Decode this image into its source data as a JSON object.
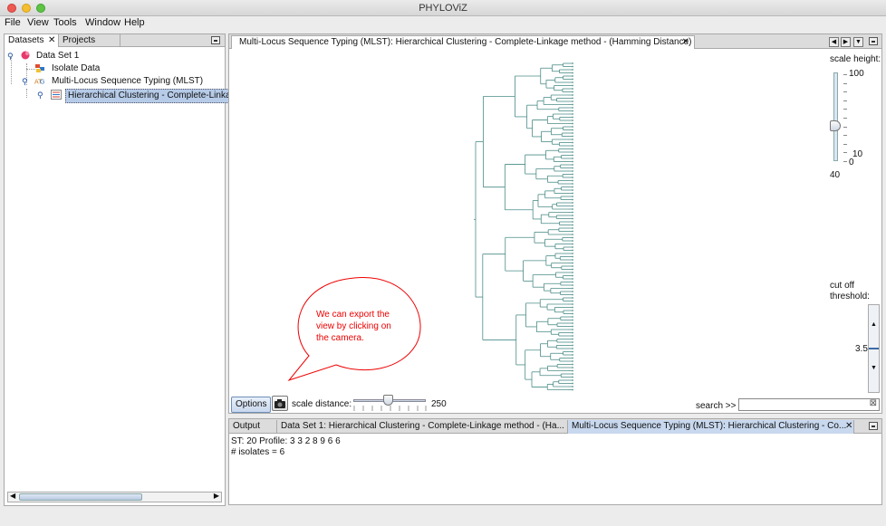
{
  "window": {
    "title": "PHYLOViZ"
  },
  "menu": [
    {
      "label": "File",
      "accel": "F"
    },
    {
      "label": "View",
      "accel": "V"
    },
    {
      "label": "Tools",
      "accel": "T"
    },
    {
      "label": "Window",
      "accel": "W"
    },
    {
      "label": "Help",
      "accel": "H"
    }
  ],
  "left_panel": {
    "tabs": [
      "Datasets",
      "Projects"
    ],
    "tree": {
      "dataset": "Data Set 1",
      "isolate": "Isolate Data",
      "mlst": "Multi-Locus Sequence Typing (MLST)",
      "clustering": "Hierarchical Clustering  - Complete-Linkage"
    }
  },
  "main_panel": {
    "tab_title": "Multi-Locus Sequence Typing (MLST): Hierarchical Clustering  - Complete-Linkage method - (Hamming Distance)",
    "scale_height": {
      "label": "scale height:",
      "ticks": [
        "100",
        "10",
        "0"
      ],
      "value": "40",
      "level": 0.4
    },
    "cutoff": {
      "label_line1": "cut off",
      "label_line2": "threshold:",
      "value": "3.5"
    },
    "options_label": "Options",
    "scale_distance_label": "scale distance:",
    "scale_distance_value": "250",
    "search_label": "search >>",
    "search_value": ""
  },
  "annotation": {
    "line1": "We can export the",
    "line2": "view  by clicking on",
    "line3": "the camera."
  },
  "output_panel": {
    "tabs": [
      "Output",
      "Data Set 1: Hierarchical Clustering  - Complete-Linkage method - (Ha...",
      "Multi-Locus Sequence Typing (MLST): Hierarchical Clustering  - Co..."
    ],
    "line1": "ST: 20 Profile: 3 3 2 8 9 6 6",
    "line2": "# isolates = 6"
  },
  "colors": {
    "dendrogram": "#4a8c87",
    "annotation": "#e00000",
    "selection": "#b6cbe8"
  }
}
